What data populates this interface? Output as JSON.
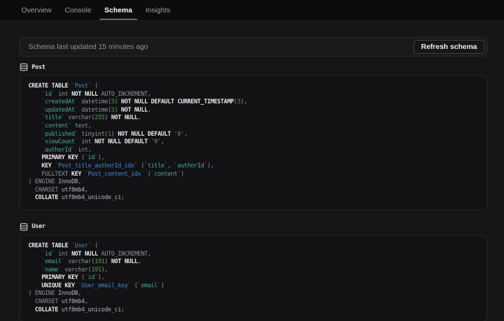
{
  "tabs": [
    {
      "label": "Overview",
      "active": false
    },
    {
      "label": "Console",
      "active": false
    },
    {
      "label": "Schema",
      "active": true
    },
    {
      "label": "Insights",
      "active": false
    }
  ],
  "status_bar": {
    "message": "Schema last updated 15 minutes ago",
    "refresh_button": "Refresh schema"
  },
  "palette": {
    "keyword": "#e8eaed",
    "identifier_column": "#45a99e",
    "identifier_table": "#4088d4",
    "number": "#55a44c",
    "string": "#55a44c",
    "muted": "#8b949e",
    "backtick": "#5b636b",
    "value": "#adb4ba",
    "active_tab_underline": "#5f6b73",
    "page_background": "#151516",
    "panel_background": "#121214"
  },
  "tables": [
    {
      "name": "Post",
      "icon": "table-icon",
      "code": [
        [
          [
            "kw",
            "CREATE TABLE "
          ],
          [
            "bt",
            "`"
          ],
          [
            "tbl",
            "Post"
          ],
          [
            "bt",
            "`"
          ],
          [
            "gy",
            " ("
          ]
        ],
        [
          [
            "gy",
            "    "
          ],
          [
            "bt",
            "`"
          ],
          [
            "col",
            "id"
          ],
          [
            "bt",
            "`"
          ],
          [
            "gy",
            " int "
          ],
          [
            "kw",
            "NOT NULL"
          ],
          [
            "gy",
            " AUTO_INCREMENT,"
          ]
        ],
        [
          [
            "gy",
            "    "
          ],
          [
            "bt",
            "`"
          ],
          [
            "col",
            "createdAt"
          ],
          [
            "bt",
            "`"
          ],
          [
            "gy",
            " datetime("
          ],
          [
            "num",
            "3"
          ],
          [
            "gy",
            ") "
          ],
          [
            "kw",
            "NOT NULL DEFAULT CURRENT_TIMESTAMP"
          ],
          [
            "gy",
            "("
          ],
          [
            "num",
            "3"
          ],
          [
            "gy",
            "),"
          ]
        ],
        [
          [
            "gy",
            "    "
          ],
          [
            "bt",
            "`"
          ],
          [
            "col",
            "updatedAt"
          ],
          [
            "bt",
            "`"
          ],
          [
            "gy",
            " datetime("
          ],
          [
            "num",
            "3"
          ],
          [
            "gy",
            ") "
          ],
          [
            "kw",
            "NOT NULL"
          ],
          [
            "gy",
            ","
          ]
        ],
        [
          [
            "gy",
            "    "
          ],
          [
            "bt",
            "`"
          ],
          [
            "col",
            "title"
          ],
          [
            "bt",
            "`"
          ],
          [
            "gy",
            " varchar("
          ],
          [
            "num",
            "255"
          ],
          [
            "gy",
            ") "
          ],
          [
            "kw",
            "NOT NULL"
          ],
          [
            "gy",
            ","
          ]
        ],
        [
          [
            "gy",
            "    "
          ],
          [
            "bt",
            "`"
          ],
          [
            "col",
            "content"
          ],
          [
            "bt",
            "`"
          ],
          [
            "gy",
            " text,"
          ]
        ],
        [
          [
            "gy",
            "    "
          ],
          [
            "bt",
            "`"
          ],
          [
            "col",
            "published"
          ],
          [
            "bt",
            "`"
          ],
          [
            "gy",
            " tinyint("
          ],
          [
            "num",
            "1"
          ],
          [
            "gy",
            ") "
          ],
          [
            "kw",
            "NOT NULL DEFAULT "
          ],
          [
            "str",
            "'0'"
          ],
          [
            "gy",
            ","
          ]
        ],
        [
          [
            "gy",
            "    "
          ],
          [
            "bt",
            "`"
          ],
          [
            "col",
            "viewCount"
          ],
          [
            "bt",
            "`"
          ],
          [
            "gy",
            " int "
          ],
          [
            "kw",
            "NOT NULL DEFAULT "
          ],
          [
            "str",
            "'0'"
          ],
          [
            "gy",
            ","
          ]
        ],
        [
          [
            "gy",
            "    "
          ],
          [
            "bt",
            "`"
          ],
          [
            "col",
            "authorId"
          ],
          [
            "bt",
            "`"
          ],
          [
            "gy",
            " int,"
          ]
        ],
        [
          [
            "gy",
            "    "
          ],
          [
            "kw",
            "PRIMARY KEY"
          ],
          [
            "gy",
            " ("
          ],
          [
            "bt",
            "`"
          ],
          [
            "col",
            "id"
          ],
          [
            "bt",
            "`"
          ],
          [
            "gy",
            "),"
          ]
        ],
        [
          [
            "gy",
            "    "
          ],
          [
            "kw",
            "KEY"
          ],
          [
            "gy",
            " "
          ],
          [
            "bt",
            "`"
          ],
          [
            "tbl",
            "Post_title_authorId_idx"
          ],
          [
            "bt",
            "`"
          ],
          [
            "gy",
            " ("
          ],
          [
            "bt",
            "`"
          ],
          [
            "col",
            "title"
          ],
          [
            "bt",
            "`"
          ],
          [
            "gy",
            ", "
          ],
          [
            "bt",
            "`"
          ],
          [
            "col",
            "authorId"
          ],
          [
            "bt",
            "`"
          ],
          [
            "gy",
            "),"
          ]
        ],
        [
          [
            "gy",
            "    "
          ],
          [
            "gy",
            "FULLTEXT "
          ],
          [
            "kw",
            "KEY"
          ],
          [
            "gy",
            " "
          ],
          [
            "bt",
            "`"
          ],
          [
            "tbl",
            "Post_content_idx"
          ],
          [
            "bt",
            "`"
          ],
          [
            "gy",
            " ("
          ],
          [
            "bt",
            "`"
          ],
          [
            "col",
            "content"
          ],
          [
            "bt",
            "`"
          ],
          [
            "gy",
            ")"
          ]
        ],
        [
          [
            "gy",
            ") ENGINE "
          ],
          [
            "val",
            "InnoDB"
          ],
          [
            "gy",
            ","
          ]
        ],
        [
          [
            "gy",
            "  CHARSET "
          ],
          [
            "val",
            "utf8mb4"
          ],
          [
            "gy",
            ","
          ]
        ],
        [
          [
            "gy",
            "  "
          ],
          [
            "kw",
            "COLLATE"
          ],
          [
            "gy",
            " "
          ],
          [
            "val",
            "utf8mb4_unicode_ci"
          ],
          [
            "gy",
            ";"
          ]
        ]
      ]
    },
    {
      "name": "User",
      "icon": "table-icon",
      "code": [
        [
          [
            "kw",
            "CREATE TABLE "
          ],
          [
            "bt",
            "`"
          ],
          [
            "tbl",
            "User"
          ],
          [
            "bt",
            "`"
          ],
          [
            "gy",
            " ("
          ]
        ],
        [
          [
            "gy",
            "    "
          ],
          [
            "bt",
            "`"
          ],
          [
            "col",
            "id"
          ],
          [
            "bt",
            "`"
          ],
          [
            "gy",
            " int "
          ],
          [
            "kw",
            "NOT NULL"
          ],
          [
            "gy",
            " AUTO_INCREMENT,"
          ]
        ],
        [
          [
            "gy",
            "    "
          ],
          [
            "bt",
            "`"
          ],
          [
            "col",
            "email"
          ],
          [
            "bt",
            "`"
          ],
          [
            "gy",
            " varchar("
          ],
          [
            "num",
            "191"
          ],
          [
            "gy",
            ") "
          ],
          [
            "kw",
            "NOT NULL"
          ],
          [
            "gy",
            ","
          ]
        ],
        [
          [
            "gy",
            "    "
          ],
          [
            "bt",
            "`"
          ],
          [
            "col",
            "name"
          ],
          [
            "bt",
            "`"
          ],
          [
            "gy",
            " varchar("
          ],
          [
            "num",
            "191"
          ],
          [
            "gy",
            "),"
          ]
        ],
        [
          [
            "gy",
            "    "
          ],
          [
            "kw",
            "PRIMARY KEY"
          ],
          [
            "gy",
            " ("
          ],
          [
            "bt",
            "`"
          ],
          [
            "col",
            "id"
          ],
          [
            "bt",
            "`"
          ],
          [
            "gy",
            "),"
          ]
        ],
        [
          [
            "gy",
            "    "
          ],
          [
            "kw",
            "UNIQUE KEY"
          ],
          [
            "gy",
            " "
          ],
          [
            "bt",
            "`"
          ],
          [
            "tbl",
            "User_email_key"
          ],
          [
            "bt",
            "`"
          ],
          [
            "gy",
            " ("
          ],
          [
            "bt",
            "`"
          ],
          [
            "col",
            "email"
          ],
          [
            "bt",
            "`"
          ],
          [
            "gy",
            ")"
          ]
        ],
        [
          [
            "gy",
            ") ENGINE "
          ],
          [
            "val",
            "InnoDB"
          ],
          [
            "gy",
            ","
          ]
        ],
        [
          [
            "gy",
            "  CHARSET "
          ],
          [
            "val",
            "utf8mb4"
          ],
          [
            "gy",
            ","
          ]
        ],
        [
          [
            "gy",
            "  "
          ],
          [
            "kw",
            "COLLATE"
          ],
          [
            "gy",
            " "
          ],
          [
            "val",
            "utf8mb4_unicode_ci"
          ],
          [
            "gy",
            ";"
          ]
        ]
      ]
    }
  ]
}
